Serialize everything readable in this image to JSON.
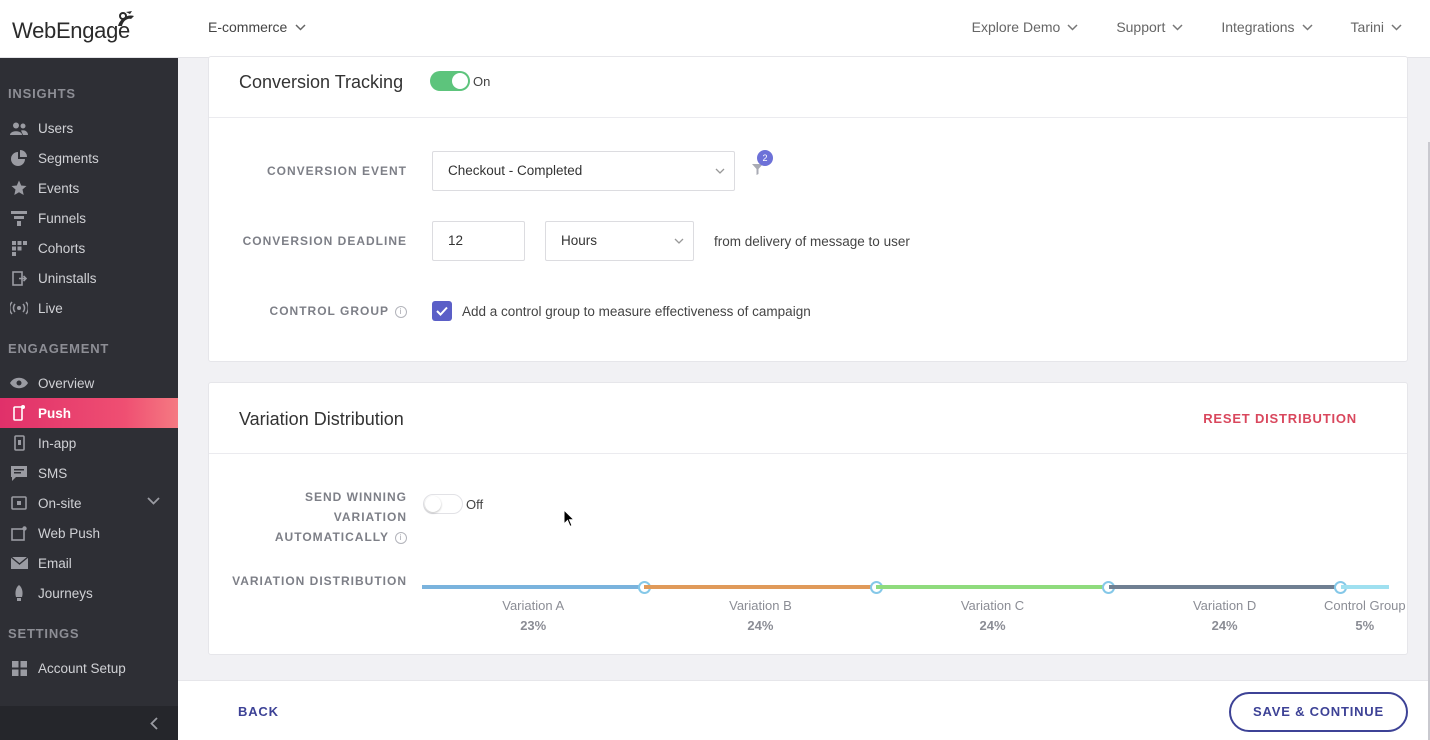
{
  "header": {
    "logo_text": "WebEngage",
    "project": "E-commerce",
    "nav": [
      {
        "label": "Explore Demo"
      },
      {
        "label": "Support"
      },
      {
        "label": "Integrations"
      },
      {
        "label": "Tarini"
      }
    ]
  },
  "sidebar": {
    "insights_title": "INSIGHTS",
    "insights": [
      {
        "label": "Users",
        "icon": "users-icon"
      },
      {
        "label": "Segments",
        "icon": "pie-chart-icon"
      },
      {
        "label": "Events",
        "icon": "star-icon"
      },
      {
        "label": "Funnels",
        "icon": "funnel-icon"
      },
      {
        "label": "Cohorts",
        "icon": "grid-icon"
      },
      {
        "label": "Uninstalls",
        "icon": "exit-icon"
      },
      {
        "label": "Live",
        "icon": "broadcast-icon"
      }
    ],
    "engagement_title": "ENGAGEMENT",
    "engagement": [
      {
        "label": "Overview",
        "icon": "eye-icon"
      },
      {
        "label": "Push",
        "icon": "mobile-icon",
        "active": true
      },
      {
        "label": "In-app",
        "icon": "phone-icon"
      },
      {
        "label": "SMS",
        "icon": "message-icon"
      },
      {
        "label": "On-site",
        "icon": "onsite-icon"
      },
      {
        "label": "Web Push",
        "icon": "web-push-icon"
      },
      {
        "label": "Email",
        "icon": "envelope-icon"
      },
      {
        "label": "Journeys",
        "icon": "journey-icon"
      }
    ],
    "settings_title": "SETTINGS",
    "settings": [
      {
        "label": "Account Setup",
        "icon": "grid-icon"
      }
    ]
  },
  "conversion": {
    "title": "Conversion Tracking",
    "toggle_label": "On",
    "event_label": "CONVERSION EVENT",
    "event_value": "Checkout - Completed",
    "filter_count": "2",
    "deadline_label": "CONVERSION DEADLINE",
    "deadline_value": "12",
    "deadline_unit": "Hours",
    "deadline_suffix": "from delivery of message to user",
    "control_label": "CONTROL GROUP",
    "control_text": "Add a control group to measure effectiveness of campaign",
    "control_checked": true
  },
  "distribution": {
    "title": "Variation Distribution",
    "reset_label": "RESET DISTRIBUTION",
    "winning_label_1": "SEND WINNING",
    "winning_label_2": "VARIATION",
    "winning_label_3": "AUTOMATICALLY",
    "winning_toggle": "Off",
    "dist_label": "VARIATION DISTRIBUTION",
    "variations": [
      {
        "name": "Variation A",
        "pct": "23%",
        "value": 23,
        "color": "#7ab3dd"
      },
      {
        "name": "Variation B",
        "pct": "24%",
        "value": 24,
        "color": "#e09a5a"
      },
      {
        "name": "Variation C",
        "pct": "24%",
        "value": 24,
        "color": "#8fdb7d"
      },
      {
        "name": "Variation D",
        "pct": "24%",
        "value": 24,
        "color": "#6f7f92"
      },
      {
        "name": "Control Group",
        "pct": "5%",
        "value": 5,
        "color": "#9fe0f0"
      }
    ]
  },
  "footer": {
    "back_label": "BACK",
    "save_label": "SAVE & CONTINUE"
  }
}
